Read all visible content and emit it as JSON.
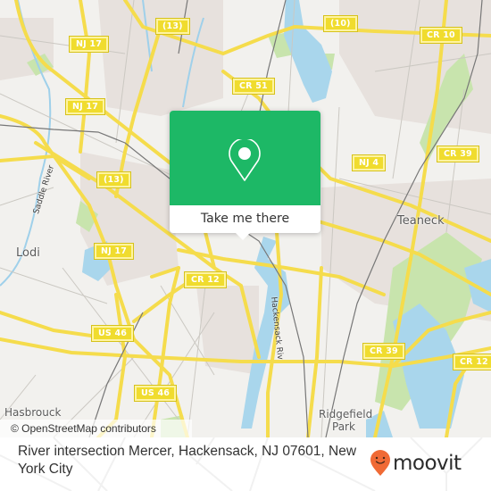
{
  "map": {
    "colors": {
      "background": "#f2f1ee",
      "urban": "#e6e0dc",
      "park": "#c5e3a8",
      "water": "#a6d5ec",
      "road_major": "#f5dc4c",
      "road_minor": "#c9c6c0",
      "rail": "#707070"
    },
    "shields": [
      {
        "id": "nj17-a",
        "label": "NJ 17"
      },
      {
        "id": "thirteen-top",
        "label": "(13)"
      },
      {
        "id": "ten",
        "label": "(10)"
      },
      {
        "id": "cr10",
        "label": "CR 10"
      },
      {
        "id": "nj17-b",
        "label": "NJ 17"
      },
      {
        "id": "cr51",
        "label": "CR 51"
      },
      {
        "id": "nj4",
        "label": "NJ 4"
      },
      {
        "id": "cr39-top",
        "label": "CR 39"
      },
      {
        "id": "thirteen-mid",
        "label": "(13)"
      },
      {
        "id": "nj17-c",
        "label": "NJ 17"
      },
      {
        "id": "cr12-mid",
        "label": "CR 12"
      },
      {
        "id": "us46-a",
        "label": "US 46"
      },
      {
        "id": "cr39-bottom",
        "label": "CR 39"
      },
      {
        "id": "cr12-right",
        "label": "CR 12"
      },
      {
        "id": "us46-b",
        "label": "US 46"
      }
    ],
    "places": [
      {
        "id": "teaneck",
        "label": "Teaneck"
      },
      {
        "id": "lodi",
        "label": "Lodi"
      },
      {
        "id": "hasbrouck",
        "label": "Hasbrouck"
      },
      {
        "id": "ridgefield",
        "label": "Ridgefield"
      },
      {
        "id": "ridgefield-park",
        "label": "Park"
      }
    ],
    "waterway_labels": [
      {
        "id": "saddle-river",
        "label": "Saddle River"
      },
      {
        "id": "hackensack-river",
        "label": "Hackensack Riv"
      }
    ],
    "attribution": "© OpenStreetMap contributors"
  },
  "popup": {
    "icon": "map-pin-icon",
    "button_label": "Take me there",
    "accent_color": "#1db866"
  },
  "footer": {
    "address": "River intersection Mercer, Hackensack, NJ 07601, New York City",
    "brand": "moovit",
    "brand_color": "#f06a35"
  }
}
